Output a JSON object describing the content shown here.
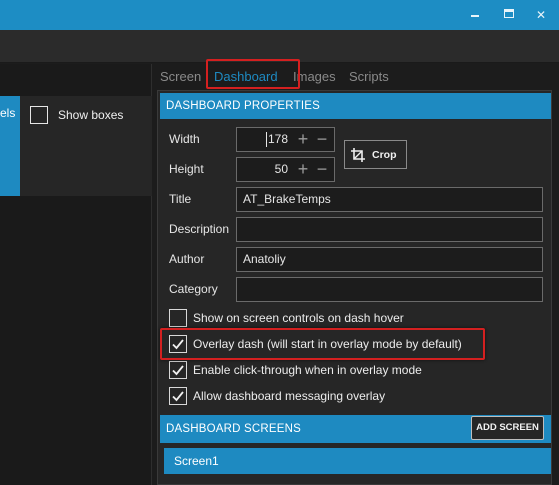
{
  "window": {
    "minimize_icon": "minimize-icon",
    "maximize_icon": "maximize-icon",
    "close_icon": "close-icon",
    "close_glyph": "✕"
  },
  "left_toolbar": {
    "labels_fragment": "els",
    "show_boxes_label": "Show boxes",
    "show_boxes_checked": false
  },
  "tabs": [
    {
      "label": "Screen",
      "active": false
    },
    {
      "label": "Dashboard",
      "active": true
    },
    {
      "label": "Images",
      "active": false
    },
    {
      "label": "Scripts",
      "active": false
    }
  ],
  "properties": {
    "header": "DASHBOARD PROPERTIES",
    "width": {
      "label": "Width",
      "value": "178"
    },
    "height": {
      "label": "Height",
      "value": "50"
    },
    "crop_label": "Crop",
    "title": {
      "label": "Title",
      "value": "AT_BrakeTemps"
    },
    "description": {
      "label": "Description",
      "value": ""
    },
    "author": {
      "label": "Author",
      "value": "Anatoliy"
    },
    "category": {
      "label": "Category",
      "value": ""
    },
    "options": [
      {
        "label": "Show on screen controls on dash hover",
        "checked": false
      },
      {
        "label": "Overlay dash (will start in overlay mode by default)",
        "checked": true
      },
      {
        "label": "Enable click-through when in overlay mode",
        "checked": true
      },
      {
        "label": "Allow dashboard messaging overlay",
        "checked": true
      }
    ]
  },
  "screens": {
    "header": "DASHBOARD SCREENS",
    "add_label": "ADD SCREEN",
    "items": [
      "Screen1"
    ]
  },
  "stepper": {
    "plus": "+",
    "minus": "−"
  },
  "colors": {
    "accent": "#1e8ac1",
    "highlight": "#d42020",
    "background": "#1c1c1c"
  }
}
